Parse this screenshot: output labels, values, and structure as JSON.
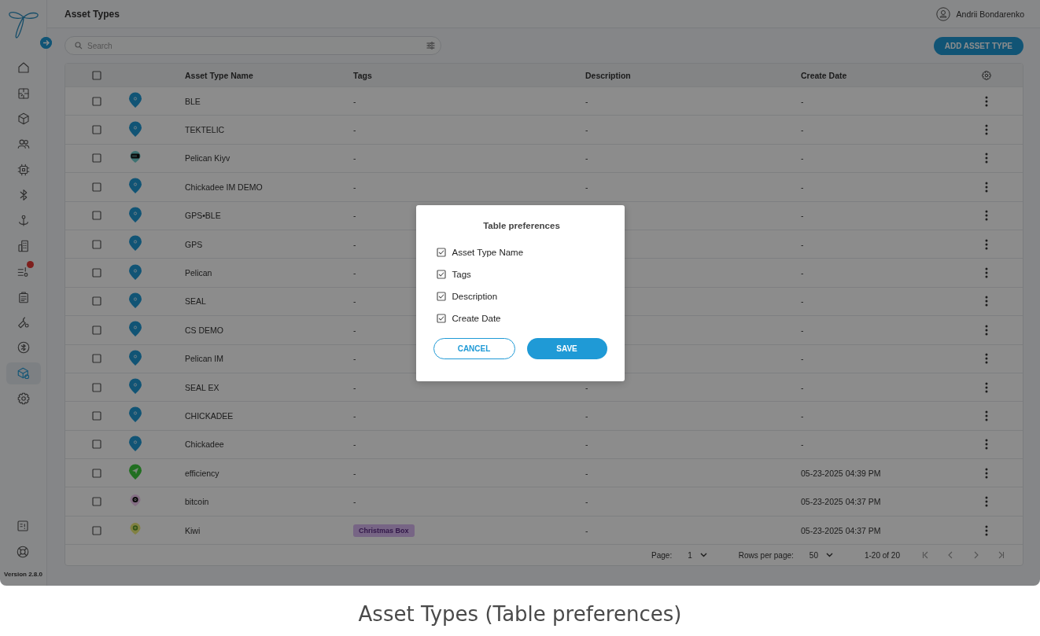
{
  "header": {
    "title": "Asset Types",
    "user_name": "Andrii Bondarenko"
  },
  "sidebar": {
    "items": [
      {
        "selected": false,
        "badge": false
      },
      {
        "selected": false,
        "badge": false
      },
      {
        "selected": false,
        "badge": false
      },
      {
        "selected": false,
        "badge": false
      },
      {
        "selected": false,
        "badge": false
      },
      {
        "selected": false,
        "badge": false
      },
      {
        "selected": false,
        "badge": false
      },
      {
        "selected": false,
        "badge": false
      },
      {
        "selected": false,
        "badge": true
      },
      {
        "selected": false,
        "badge": false
      },
      {
        "selected": false,
        "badge": false
      },
      {
        "selected": false,
        "badge": false
      },
      {
        "selected": true,
        "badge": false
      },
      {
        "selected": false,
        "badge": false
      }
    ],
    "version": "Version 2.8.0"
  },
  "toolbar": {
    "search": {
      "placeholder": "Search"
    },
    "add_button": "ADD ASSET TYPE"
  },
  "table": {
    "select_all": {
      "checked": false
    },
    "columns": [
      "Asset Type Name",
      "Tags",
      "Description",
      "Create Date"
    ],
    "rows": [
      {
        "checked": false,
        "marker": {
          "kind": "pin"
        },
        "name": "BLE",
        "tags": {
          "kind": "plain",
          "text": "-"
        },
        "description": "-",
        "create_date": "-"
      },
      {
        "checked": false,
        "marker": {
          "kind": "pin"
        },
        "name": "TEKTELIC",
        "tags": {
          "kind": "plain",
          "text": "-"
        },
        "description": "-",
        "create_date": "-"
      },
      {
        "checked": false,
        "marker": {
          "kind": "battery"
        },
        "name": "Pelican Kiyv",
        "tags": {
          "kind": "plain",
          "text": "-"
        },
        "description": "-",
        "create_date": "-"
      },
      {
        "checked": false,
        "marker": {
          "kind": "pin"
        },
        "name": "Chickadee IM DEMO",
        "tags": {
          "kind": "plain",
          "text": "-"
        },
        "description": "-",
        "create_date": "-"
      },
      {
        "checked": false,
        "marker": {
          "kind": "pin"
        },
        "name": "GPS•BLE",
        "tags": {
          "kind": "plain",
          "text": "-"
        },
        "create_date": "-"
      },
      {
        "checked": false,
        "marker": {
          "kind": "pin"
        },
        "name": "GPS",
        "tags": {
          "kind": "plain",
          "text": "-"
        },
        "create_date": "-"
      },
      {
        "checked": false,
        "marker": {
          "kind": "pin"
        },
        "name": "Pelican",
        "tags": {
          "kind": "plain",
          "text": "-"
        },
        "create_date": "-"
      },
      {
        "checked": false,
        "marker": {
          "kind": "pin"
        },
        "name": "SEAL",
        "tags": {
          "kind": "plain",
          "text": "-"
        },
        "create_date": "-"
      },
      {
        "checked": false,
        "marker": {
          "kind": "pin"
        },
        "name": "CS DEMO",
        "tags": {
          "kind": "plain",
          "text": "-"
        },
        "create_date": "-"
      },
      {
        "checked": false,
        "marker": {
          "kind": "pin"
        },
        "name": "Pelican IM",
        "tags": {
          "kind": "plain",
          "text": "-"
        },
        "create_date": "-"
      },
      {
        "checked": false,
        "marker": {
          "kind": "pin"
        },
        "name": "SEAL EX",
        "tags": {
          "kind": "plain",
          "text": "-"
        },
        "description": "-",
        "create_date": "-"
      },
      {
        "checked": false,
        "marker": {
          "kind": "pin"
        },
        "name": "CHICKADEE",
        "tags": {
          "kind": "plain",
          "text": "-"
        },
        "description": "-",
        "create_date": "-"
      },
      {
        "checked": false,
        "marker": {
          "kind": "pin"
        },
        "name": "Chickadee",
        "tags": {
          "kind": "plain",
          "text": "-"
        },
        "description": "-",
        "create_date": "-"
      },
      {
        "checked": false,
        "marker": {
          "kind": "send"
        },
        "name": "efficiency",
        "tags": {
          "kind": "plain",
          "text": "-"
        },
        "description": "-",
        "create_date": "05-23-2025 04:39 PM"
      },
      {
        "checked": false,
        "marker": {
          "kind": "coin"
        },
        "name": "bitcoin",
        "tags": {
          "kind": "plain",
          "text": "-"
        },
        "description": "-",
        "create_date": "05-23-2025 04:37 PM"
      },
      {
        "checked": false,
        "marker": {
          "kind": "plus"
        },
        "name": "Kiwi",
        "tags": {
          "kind": "chip",
          "text": "Christmas Box"
        },
        "description": "-",
        "create_date": "05-23-2025 04:37 PM"
      }
    ]
  },
  "pagination": {
    "page_label": "Page:",
    "page": "1",
    "rows_label": "Rows per page:",
    "rows_per_page": "50",
    "range": "1-20 of 20"
  },
  "modal": {
    "title": "Table preferences",
    "options": [
      {
        "label": "Asset Type Name",
        "checked": true
      },
      {
        "label": "Tags",
        "checked": true
      },
      {
        "label": "Description",
        "checked": true
      },
      {
        "label": "Create Date",
        "checked": true
      }
    ],
    "cancel": "CANCEL",
    "save": "SAVE"
  },
  "caption": "Asset Types (Table preferences)"
}
